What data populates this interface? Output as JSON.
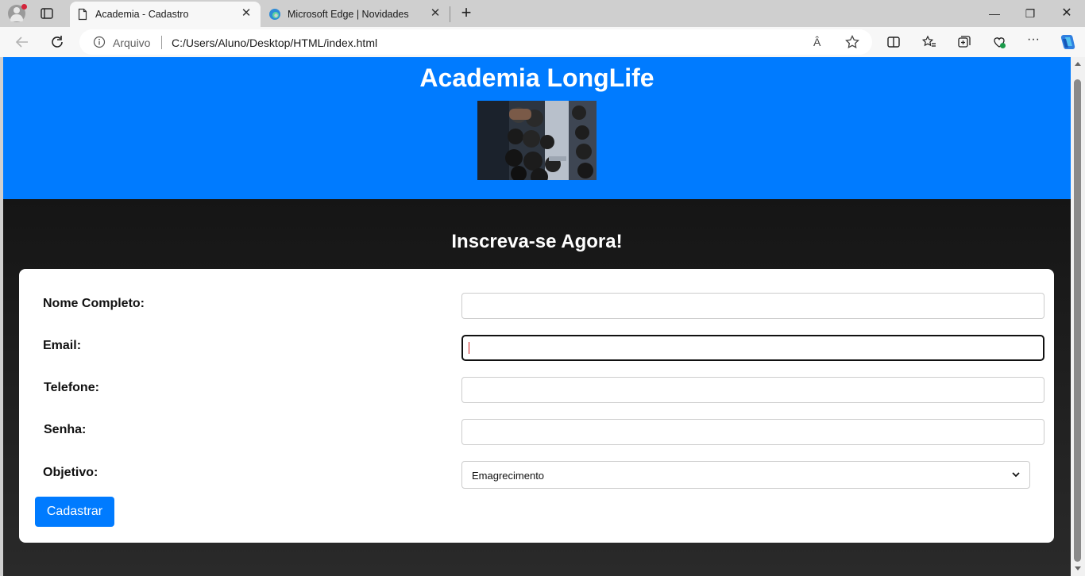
{
  "browser": {
    "tabs": [
      {
        "label": "Academia - Cadastro",
        "active": true
      },
      {
        "label": "Microsoft Edge | Novidades",
        "active": false
      }
    ],
    "address_prefix": "Arquivo",
    "url": "C:/Users/Aluno/Desktop/HTML/index.html",
    "read_aloud_label": "Â"
  },
  "page": {
    "title": "Academia LongLife",
    "form_heading": "Inscreva-se Agora!",
    "fields": [
      {
        "label": "Nome Completo:",
        "value": ""
      },
      {
        "label": "Email:",
        "value": ""
      },
      {
        "label": "Telefone:",
        "value": ""
      },
      {
        "label": "Senha:",
        "value": ""
      }
    ],
    "objetivo": {
      "label": "Objetivo:",
      "selected": "Emagrecimento"
    },
    "submit_label": "Cadastrar"
  },
  "colors": {
    "header_bg": "#007bff",
    "button_bg": "#007bff",
    "page_bg": "#2b2b2b"
  }
}
